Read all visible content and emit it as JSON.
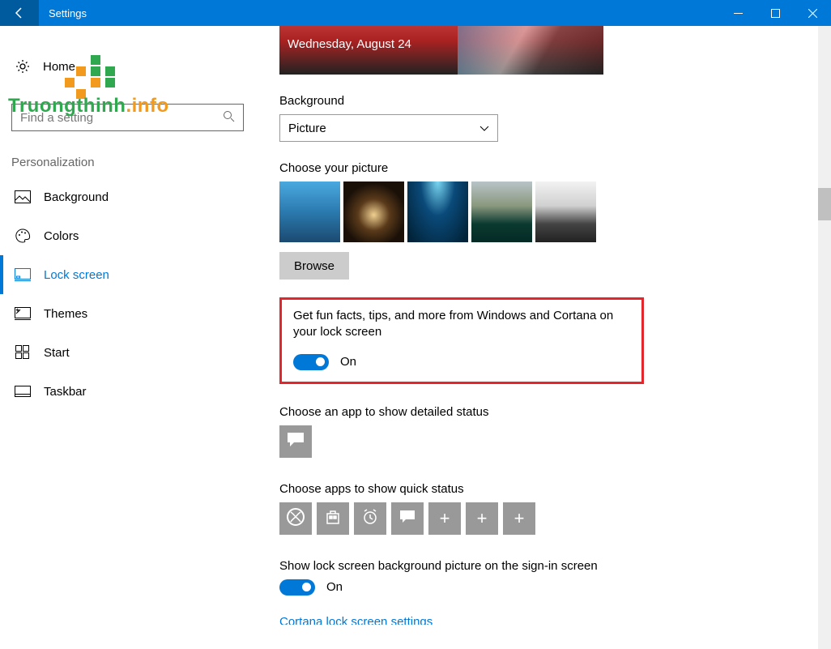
{
  "window": {
    "title": "Settings"
  },
  "sidebar": {
    "home": "Home",
    "search_placeholder": "Find a setting",
    "section": "Personalization",
    "items": [
      {
        "label": "Background"
      },
      {
        "label": "Colors"
      },
      {
        "label": "Lock screen"
      },
      {
        "label": "Themes"
      },
      {
        "label": "Start"
      },
      {
        "label": "Taskbar"
      }
    ]
  },
  "main": {
    "preview_date": "Wednesday, August 24",
    "background_label": "Background",
    "background_value": "Picture",
    "choose_picture_label": "Choose your picture",
    "browse_label": "Browse",
    "funfacts_label": "Get fun facts, tips, and more from Windows and Cortana on your lock screen",
    "funfacts_state": "On",
    "detailed_status_label": "Choose an app to show detailed status",
    "quick_status_label": "Choose apps to show quick status",
    "signin_label": "Show lock screen background picture on the sign-in screen",
    "signin_state": "On",
    "cortana_link": "Cortana lock screen settings"
  },
  "watermark": {
    "text_a": "Truongthinh",
    "text_b": ".info"
  }
}
